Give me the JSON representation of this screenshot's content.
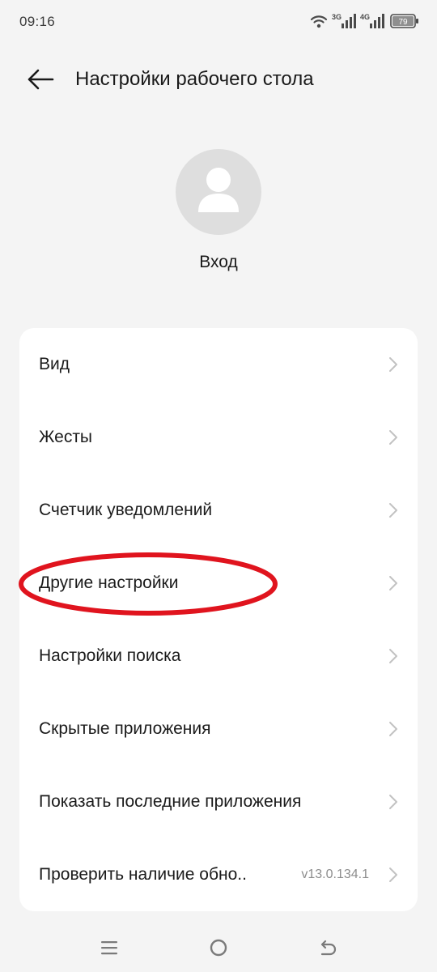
{
  "status_bar": {
    "time": "09:16",
    "network_1": "3G",
    "network_2": "4G",
    "battery": "79",
    "icons": [
      "wifi-icon",
      "signal-icon",
      "signal-icon",
      "battery-icon"
    ]
  },
  "header": {
    "title": "Настройки рабочего стола",
    "back_icon": "arrow-left-icon"
  },
  "profile": {
    "avatar_icon": "person-icon",
    "login_label": "Вход"
  },
  "settings": {
    "items": [
      {
        "label": "Вид",
        "value": ""
      },
      {
        "label": "Жесты",
        "value": ""
      },
      {
        "label": "Счетчик уведомлений",
        "value": ""
      },
      {
        "label": "Другие настройки",
        "value": ""
      },
      {
        "label": "Настройки поиска",
        "value": ""
      },
      {
        "label": "Скрытые приложения",
        "value": ""
      },
      {
        "label": "Показать последние приложения",
        "value": ""
      },
      {
        "label": "Проверить наличие обно..",
        "value": "v13.0.134.1"
      }
    ],
    "highlighted_item": "Другие настройки",
    "highlight_color": "#e0141e"
  },
  "nav_bar": {
    "icons": [
      "menu-icon",
      "home-icon",
      "back-icon"
    ]
  },
  "colors": {
    "background": "#f4f4f4",
    "card": "#ffffff",
    "avatar_bg": "#dedede",
    "chevron": "#c2c2c2",
    "annotation": "#e0141e"
  }
}
